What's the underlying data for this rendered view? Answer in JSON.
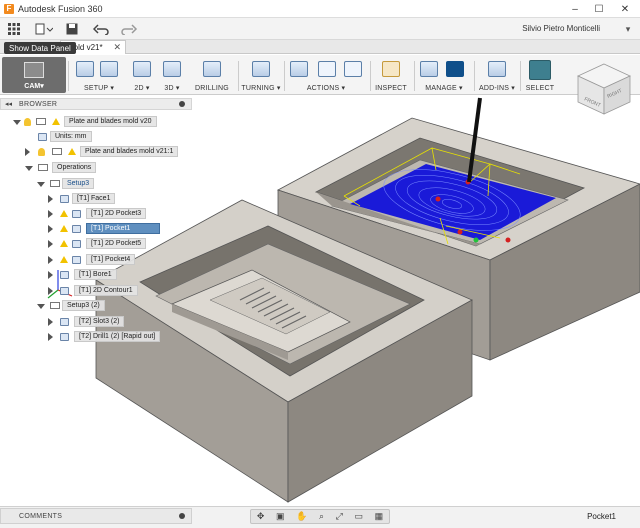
{
  "window": {
    "title": "Autodesk Fusion 360",
    "user": "Silvio Pietro Monticelli",
    "controls": [
      "–",
      "☐",
      "✕"
    ]
  },
  "quick_access": {
    "grid_icon": "grid-icon",
    "file_icon": "file-icon",
    "save_icon": "save-icon",
    "undo_icon": "undo-icon",
    "redo_icon": "redo-icon",
    "close_icon": "close-icon"
  },
  "tabs": {
    "doc_tab_label": "mold v21*",
    "tooltip": "Show Data Panel"
  },
  "toolbar": {
    "workspace": "CAM",
    "groups": [
      {
        "label": "SETUP"
      },
      {
        "label": "2D"
      },
      {
        "label": "3D"
      },
      {
        "label": "DRILLING"
      },
      {
        "label": "TURNING"
      },
      {
        "label": "ACTIONS"
      },
      {
        "label": "INSPECT"
      },
      {
        "label": "MANAGE"
      },
      {
        "label": "ADD-INS"
      },
      {
        "label": "SELECT"
      }
    ]
  },
  "browser": {
    "title": "BROWSER",
    "rows": [
      {
        "label": "Plate and blades mold v20"
      },
      {
        "label": "Units: mm"
      },
      {
        "label": "Plate and blades mold v21:1"
      },
      {
        "label": "Operations"
      },
      {
        "label": "Setup3"
      },
      {
        "label": "[T1] Face1"
      },
      {
        "label": "[T1] 2D Pocket3"
      },
      {
        "label": "[T1] Pocket1"
      },
      {
        "label": "[T1] 2D Pocket5"
      },
      {
        "label": "[T1] Pocket4"
      },
      {
        "label": "[T1] Bore1"
      },
      {
        "label": "[T1] 2D Contour1"
      },
      {
        "label": "Setup3 (2)"
      },
      {
        "label": "[T2] Slot3 (2)"
      },
      {
        "label": "[T2] Drill1 (2) [Rapid out]"
      }
    ]
  },
  "viewcube": {
    "front": "FRONT",
    "right": "RIGHT"
  },
  "bottom": {
    "comments": "COMMENTS",
    "status": "Pocket1"
  },
  "colors": {
    "toolpath": "#1a1ad8",
    "stock": "#bfbab2",
    "selected": "#5f8fbf"
  }
}
